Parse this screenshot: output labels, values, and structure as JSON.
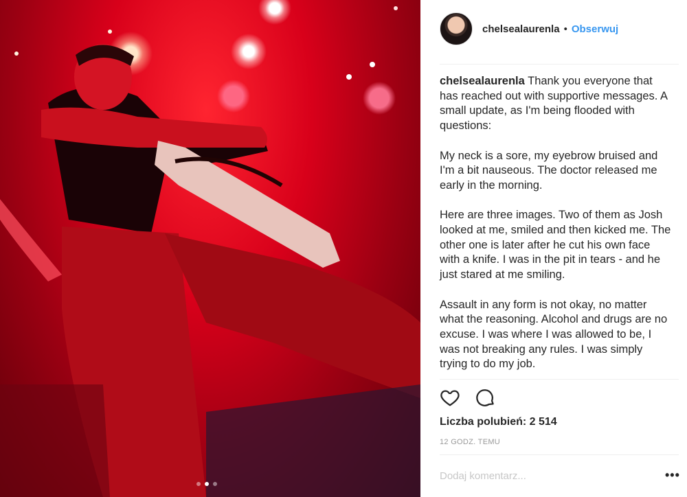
{
  "post": {
    "image_alt_icon": "concert-photo",
    "carousel": {
      "count": 3,
      "active_index": 1
    }
  },
  "header": {
    "username": "chelsealaurenla",
    "separator": "•",
    "follow_label": "Obserwuj"
  },
  "caption": {
    "username": "chelsealaurenla",
    "text": "Thank you everyone that has reached out with supportive messages. A small update, as I'm being flooded with questions:\n\nMy neck is a sore, my eyebrow bruised and I'm a bit nauseous. The doctor released me early in the morning.\n\nHere are three images. Two of them as Josh looked at me, smiled and then kicked me. The other one is later after he cut his own face with a knife. I was in the pit in tears - and he just stared at me smiling.\n\nAssault in any form is not okay, no matter what the reasoning. Alcohol and drugs are no excuse. I was where I was allowed to be, I was not breaking any rules. I was simply trying to do my job."
  },
  "actions": {
    "like_icon": "heart-icon",
    "comment_icon": "comment-icon"
  },
  "likes_text": "Liczba polubień: 2 514",
  "timestamp": "12 GODZ. TEMU",
  "comment": {
    "placeholder": "Dodaj komentarz...",
    "more_label": "•••"
  },
  "colors": {
    "accent": "#3897f0",
    "text": "#262626",
    "muted": "#999999"
  }
}
